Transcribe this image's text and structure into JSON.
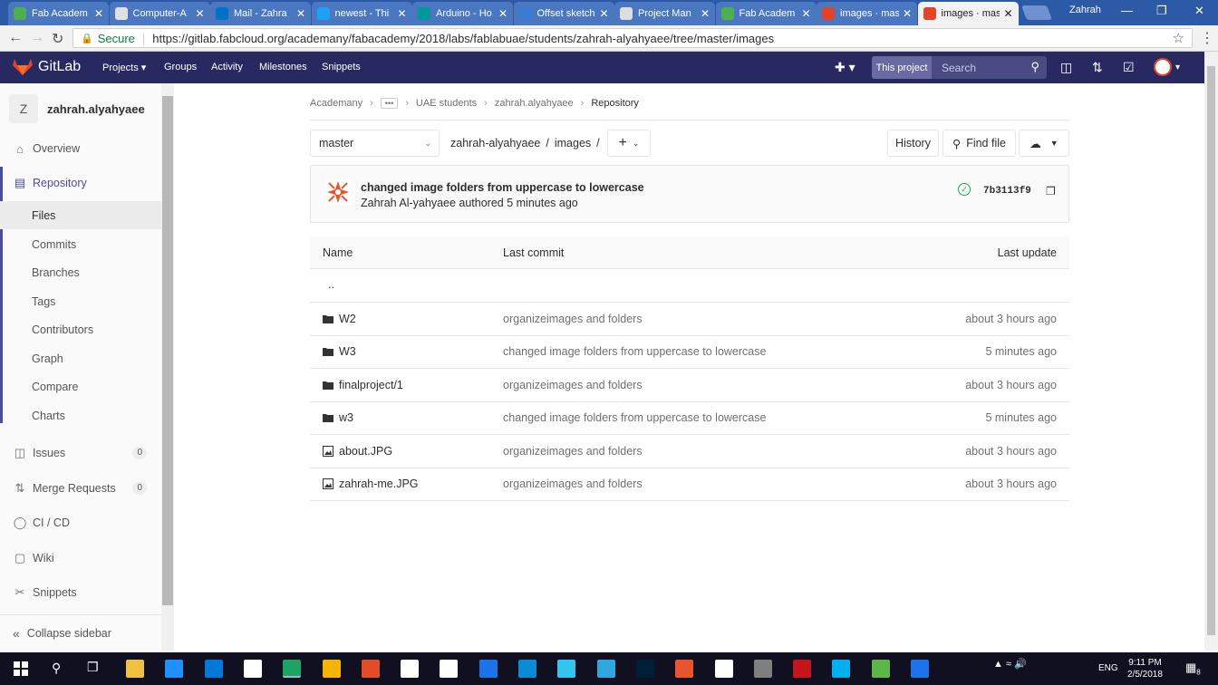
{
  "browser": {
    "tabs": [
      {
        "label": "Fab Academ",
        "color": "#4caf50"
      },
      {
        "label": "Computer-A",
        "color": "#e0e0e0"
      },
      {
        "label": "Mail - Zahra",
        "color": "#0072c6"
      },
      {
        "label": "newest - Thi",
        "color": "#1da1f2"
      },
      {
        "label": "Arduino - Ho",
        "color": "#00979d"
      },
      {
        "label": "Offset sketch",
        "color": "#3a7bd5"
      },
      {
        "label": "Project Man",
        "color": "#dddddd"
      },
      {
        "label": "Fab Academ",
        "color": "#4caf50"
      },
      {
        "label": "images · mas",
        "color": "#e24329"
      },
      {
        "label": "images · mas",
        "color": "#e24329"
      }
    ],
    "active_tab": 9,
    "user": "Zahrah",
    "secure_label": "Secure",
    "url": "https://gitlab.fabcloud.org/academany/fabacademy/2018/labs/fablabuae/students/zahrah-alyahyaee/tree/master/images"
  },
  "header": {
    "brand": "GitLab",
    "nav": [
      "Projects",
      "Groups",
      "Activity",
      "Milestones",
      "Snippets"
    ],
    "search_scope": "This project",
    "search_placeholder": "Search"
  },
  "sidebar": {
    "avatar_letter": "Z",
    "project_name": "zahrah.alyahyaee",
    "overview": "Overview",
    "repository": "Repository",
    "repo_items": [
      "Files",
      "Commits",
      "Branches",
      "Tags",
      "Contributors",
      "Graph",
      "Compare",
      "Charts"
    ],
    "issues": "Issues",
    "issues_count": "0",
    "merge_requests": "Merge Requests",
    "mr_count": "0",
    "cicd": "CI / CD",
    "wiki": "Wiki",
    "snippets": "Snippets",
    "collapse": "Collapse sidebar"
  },
  "breadcrumb": {
    "items": [
      "Academany",
      "UAE students",
      "zahrah.alyahyaee"
    ],
    "current": "Repository"
  },
  "toolbar": {
    "branch": "master",
    "path": [
      "zahrah-alyahyaee",
      "/",
      "images",
      "/"
    ],
    "history": "History",
    "find_file": "Find file"
  },
  "commit": {
    "message": "changed image folders from uppercase to lowercase",
    "author": "Zahrah Al-yahyaee authored 5 minutes ago",
    "sha": "7b3113f9"
  },
  "table": {
    "headers": [
      "Name",
      "Last commit",
      "Last update"
    ],
    "parent": "..",
    "rows": [
      {
        "type": "folder",
        "name": "W2",
        "commit": "organizeimages and folders",
        "updated": "about 3 hours ago"
      },
      {
        "type": "folder",
        "name": "W3",
        "commit": "changed image folders from uppercase to lowercase",
        "updated": "5 minutes ago"
      },
      {
        "type": "folder",
        "name": "finalproject/1",
        "commit": "organizeimages and folders",
        "updated": "about 3 hours ago"
      },
      {
        "type": "folder",
        "name": "w3",
        "commit": "changed image folders from uppercase to lowercase",
        "updated": "5 minutes ago"
      },
      {
        "type": "image",
        "name": "about.JPG",
        "commit": "organizeimages and folders",
        "updated": "about 3 hours ago"
      },
      {
        "type": "image",
        "name": "zahrah-me.JPG",
        "commit": "organizeimages and folders",
        "updated": "about 3 hours ago"
      }
    ]
  },
  "taskbar": {
    "lang": "ENG",
    "time": "9:11 PM",
    "date": "2/5/2018",
    "notif_count": "8",
    "apps": [
      "#f0c040",
      "#1e90ff",
      "#0078d7",
      "#ffffff",
      "#1da362",
      "#f5b400",
      "#e34c26",
      "#ffffff",
      "#ffffff",
      "#1a73e8",
      "#0b8ad6",
      "#31c5f0",
      "#30a6df",
      "#001e36",
      "#e8542c",
      "#ffffff",
      "#7f7f7f",
      "#c4161c",
      "#00aff0",
      "#5db746",
      "#1a73e8"
    ]
  }
}
